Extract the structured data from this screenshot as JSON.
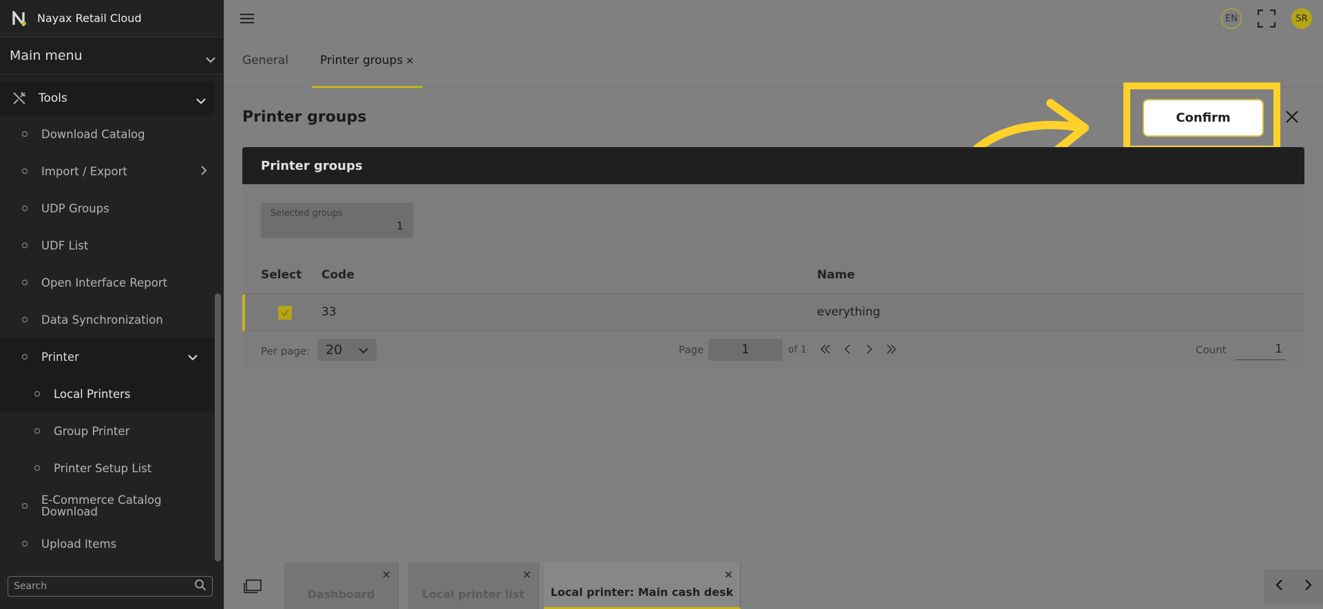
{
  "app": {
    "title": "Nayax Retail Cloud"
  },
  "sidebar": {
    "main_menu": "Main menu",
    "section": "Tools",
    "items": [
      {
        "label": "Download Catalog"
      },
      {
        "label": "Import / Export"
      },
      {
        "label": "UDP Groups"
      },
      {
        "label": "UDF List"
      },
      {
        "label": "Open Interface Report"
      },
      {
        "label": "Data Synchronization"
      },
      {
        "label": "Printer"
      },
      {
        "label": "Local Printers"
      },
      {
        "label": "Group Printer"
      },
      {
        "label": "Printer Setup List"
      },
      {
        "label": "E-Commerce Catalog Download"
      },
      {
        "label": "Upload Items"
      }
    ],
    "search_placeholder": "Search"
  },
  "topbar": {
    "language": "EN",
    "avatar_initials": "SR"
  },
  "tabs": [
    {
      "label": "General"
    },
    {
      "label": "Printer groups",
      "close": "×"
    }
  ],
  "page": {
    "title": "Printer groups",
    "confirm_label": "Confirm",
    "close_symbol": "✕"
  },
  "card": {
    "header": "Printer groups",
    "selected_label": "Selected groups",
    "selected_value": "1",
    "columns": [
      "Select",
      "Code",
      "Name"
    ],
    "rows": [
      {
        "selected": true,
        "code": "33",
        "name": "everything"
      }
    ],
    "footer": {
      "per_page_label": "Per page:",
      "per_page_value": "20",
      "page_label": "Page",
      "page_value": "1",
      "of_label": "of 1",
      "count_label": "Count",
      "count_value": "1"
    }
  },
  "bottom_tabs": [
    {
      "label": "Dashboard",
      "close": "×"
    },
    {
      "label": "Local printer list",
      "close": "×"
    },
    {
      "label": "Local printer: Main cash desk",
      "close": "×"
    }
  ],
  "colors": {
    "accent": "#c7b21c",
    "highlight": "#ffd12a",
    "sidebar_bg": "#222222",
    "overlay_bg": "#808080"
  }
}
